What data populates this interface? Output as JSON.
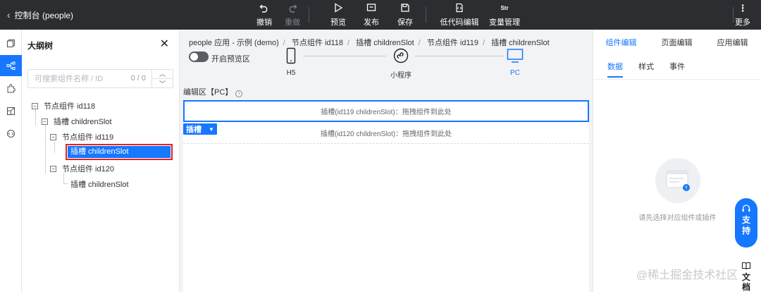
{
  "topbar": {
    "back_label": "控制台 (people)",
    "buttons": [
      {
        "label": "撤销",
        "icon": "undo-icon"
      },
      {
        "label": "重做",
        "icon": "redo-icon"
      },
      {
        "label": "预览",
        "icon": "play-icon"
      },
      {
        "label": "发布",
        "icon": "publish-icon"
      },
      {
        "label": "保存",
        "icon": "save-icon"
      },
      {
        "label": "低代码编辑",
        "icon": "code-file-icon"
      },
      {
        "label": "变量管理",
        "icon": "variable-icon",
        "icon_text": "Str"
      }
    ],
    "more_label": "更多"
  },
  "outline": {
    "title": "大纲树",
    "search_placeholder": "可搜索组件名称 / ID",
    "search_count": "0 / 0",
    "nodes": [
      {
        "toggle": "−",
        "label": "节点组件 id118"
      },
      {
        "toggle": "−",
        "label": "插槽 childrenSlot"
      },
      {
        "toggle": "−",
        "label": "节点组件 id119"
      },
      {
        "toggle": "",
        "label": "插槽 childrenSlot"
      },
      {
        "toggle": "−",
        "label": "节点组件 id120"
      },
      {
        "toggle": "",
        "label": "插槽 childrenSlot"
      }
    ]
  },
  "center": {
    "breadcrumb": [
      "people 应用 - 示例 (demo)",
      "节点组件 id118",
      "插槽 childrenSlot",
      "节点组件 id119",
      "插槽 childrenSlot"
    ],
    "preview_toggle_label": "开启预览区",
    "devices": [
      {
        "label": "H5",
        "icon": "phone-icon"
      },
      {
        "label": "小程序",
        "icon": "miniprogram-icon"
      },
      {
        "label": "PC",
        "icon": "monitor-icon"
      }
    ],
    "active_device": "PC",
    "edit_area_label": "编辑区【PC】",
    "slot1_text": "插槽(id119 childrenSlot)：拖拽组件到此处",
    "slot2_text": "插槽(id120 childrenSlot)：拖拽组件到此处",
    "slot_tag": "插槽"
  },
  "right": {
    "tabs": [
      "组件编辑",
      "页面编辑",
      "应用编辑"
    ],
    "subtabs": [
      "数据",
      "样式",
      "事件"
    ],
    "empty_text": "请先选择对应组件或插件"
  },
  "floating": {
    "support_label": [
      "支",
      "持"
    ],
    "docs_label": [
      "文",
      "档"
    ]
  },
  "watermark": "@稀土掘金技术社区",
  "colors": {
    "accent": "#1677ff",
    "topbar": "#2b2d31",
    "highlight": "#e02424"
  }
}
